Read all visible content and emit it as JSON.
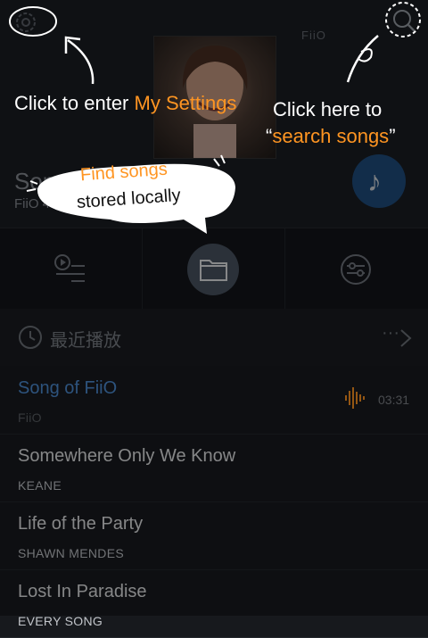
{
  "header": {
    "logo_text": "FiiO",
    "now_playing_title": "Song of FiiO",
    "now_playing_meta": "FiiO 44KHz 1411kbps",
    "accent_color": "#1f4f80"
  },
  "tabs": [
    {
      "name": "playlist-icon"
    },
    {
      "name": "folder-icon"
    },
    {
      "name": "equalizer-icon"
    }
  ],
  "recent": {
    "label": "最近播放",
    "more": "···"
  },
  "songs": [
    {
      "title": "Song of FiiO",
      "artist": "FiiO",
      "time": "03:31",
      "playing": true
    },
    {
      "title": "Somewhere Only We Know",
      "artist": "KEANE"
    },
    {
      "title": "Life of the Party",
      "artist": "SHAWN MENDES"
    },
    {
      "title": "Lost In Paradise",
      "artist": "EVERY SONG"
    }
  ],
  "hints": {
    "settings_prefix": "Click to enter ",
    "settings_highlight": "My Settings",
    "search_line1": "Click here to",
    "search_open": "“",
    "search_highlight": "search songs",
    "search_close": "”",
    "local_line1": "Find songs",
    "local_line2": "stored locally"
  },
  "colors": {
    "highlight": "#ff9522",
    "playing": "#4f8fd8",
    "background": "#17191d"
  }
}
